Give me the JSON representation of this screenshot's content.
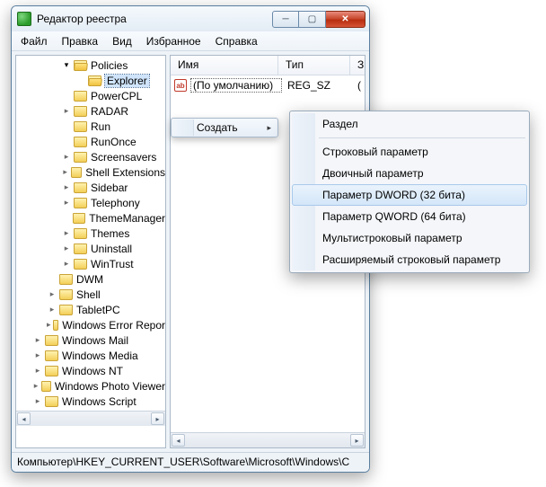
{
  "window": {
    "title": "Редактор реестра"
  },
  "menubar": [
    "Файл",
    "Правка",
    "Вид",
    "Избранное",
    "Справка"
  ],
  "columns": {
    "name": "Имя",
    "type": "Тип",
    "extra": "З"
  },
  "default_value": {
    "icon_text": "ab",
    "name": "(По умолчанию)",
    "type": "REG_SZ",
    "extra": "("
  },
  "tree": [
    {
      "depth": 1,
      "label": "Policies",
      "open": true,
      "expander": "▾"
    },
    {
      "depth": 2,
      "label": "Explorer",
      "open": true,
      "selected": true,
      "expander": ""
    },
    {
      "depth": 1,
      "label": "PowerCPL",
      "expander": ""
    },
    {
      "depth": 1,
      "label": "RADAR",
      "expander": "▸"
    },
    {
      "depth": 1,
      "label": "Run",
      "expander": ""
    },
    {
      "depth": 1,
      "label": "RunOnce",
      "expander": ""
    },
    {
      "depth": 1,
      "label": "Screensavers",
      "expander": "▸"
    },
    {
      "depth": 1,
      "label": "Shell Extensions",
      "expander": "▸"
    },
    {
      "depth": 1,
      "label": "Sidebar",
      "expander": "▸"
    },
    {
      "depth": 1,
      "label": "Telephony",
      "expander": "▸"
    },
    {
      "depth": 1,
      "label": "ThemeManager",
      "expander": ""
    },
    {
      "depth": 1,
      "label": "Themes",
      "expander": "▸"
    },
    {
      "depth": 1,
      "label": "Uninstall",
      "expander": "▸"
    },
    {
      "depth": 1,
      "label": "WinTrust",
      "expander": "▸"
    },
    {
      "depth": 0,
      "label": "DWM",
      "expander": ""
    },
    {
      "depth": 0,
      "label": "Shell",
      "expander": "▸"
    },
    {
      "depth": 0,
      "label": "TabletPC",
      "expander": "▸"
    },
    {
      "depth": 0,
      "label": "Windows Error Repor",
      "expander": "▸"
    },
    {
      "depth": -1,
      "label": "Windows Mail",
      "expander": "▸"
    },
    {
      "depth": -1,
      "label": "Windows Media",
      "expander": "▸"
    },
    {
      "depth": -1,
      "label": "Windows NT",
      "expander": "▸"
    },
    {
      "depth": -1,
      "label": "Windows Photo Viewer",
      "expander": "▸"
    },
    {
      "depth": -1,
      "label": "Windows Script",
      "expander": "▸"
    }
  ],
  "context_menu": {
    "trigger": "Создать",
    "items": [
      {
        "label": "Раздел"
      },
      {
        "sep": true
      },
      {
        "label": "Строковый параметр"
      },
      {
        "label": "Двоичный параметр"
      },
      {
        "label": "Параметр DWORD (32 бита)",
        "highlight": true
      },
      {
        "label": "Параметр QWORD (64 бита)"
      },
      {
        "label": "Мультистроковый параметр"
      },
      {
        "label": "Расширяемый строковый параметр"
      }
    ]
  },
  "statusbar": "Компьютер\\HKEY_CURRENT_USER\\Software\\Microsoft\\Windows\\C"
}
